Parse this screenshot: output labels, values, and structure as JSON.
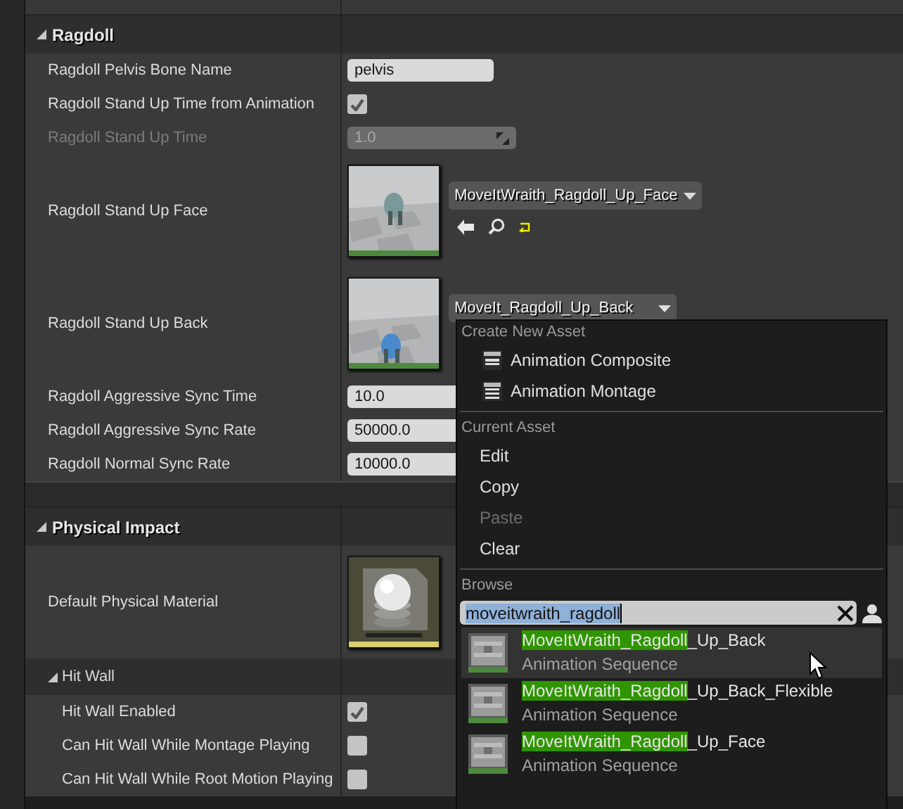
{
  "sections": [
    {
      "title": "Ragdoll",
      "expanded": true,
      "items": [
        {
          "kind": "text",
          "label": "Ragdoll Pelvis Bone Name",
          "value": "pelvis",
          "disabled": false
        },
        {
          "kind": "checkbox",
          "label": "Ragdoll Stand Up Time from Animation",
          "checked": true,
          "disabled": false
        },
        {
          "kind": "number",
          "label": "Ragdoll Stand Up Time",
          "value": "1.0",
          "disabled": true
        },
        {
          "kind": "asset",
          "label": "Ragdoll Stand Up Face",
          "value": "MoveItWraith_Ragdoll_Up_Face",
          "menu_open": false,
          "disabled": false
        },
        {
          "kind": "asset",
          "label": "Ragdoll Stand Up Back",
          "value": "MoveIt_Ragdoll_Up_Back",
          "menu_open": true,
          "disabled": false
        },
        {
          "kind": "number",
          "label": "Ragdoll Aggressive Sync Time",
          "value": "10.0",
          "disabled": false
        },
        {
          "kind": "number",
          "label": "Ragdoll Aggressive Sync Rate",
          "value": "50000.0",
          "disabled": false
        },
        {
          "kind": "number",
          "label": "Ragdoll Normal Sync Rate",
          "value": "10000.0",
          "disabled": false
        }
      ]
    },
    {
      "title": "Physical Impact",
      "expanded": true,
      "items": [
        {
          "kind": "material",
          "label": "Default Physical Material",
          "disabled": false
        },
        {
          "kind": "group",
          "title": "Hit Wall",
          "expanded": true,
          "items": [
            {
              "kind": "checkbox",
              "label": "Hit Wall Enabled",
              "checked": true,
              "disabled": false
            },
            {
              "kind": "checkbox",
              "label": "Can Hit Wall While Montage Playing",
              "checked": false,
              "disabled": false
            },
            {
              "kind": "checkbox",
              "label": "Can Hit Wall While Root Motion Playing",
              "checked": false,
              "disabled": false
            }
          ]
        }
      ]
    }
  ],
  "asset_menu": {
    "groups": [
      {
        "title": "Create New Asset",
        "items": [
          {
            "label": "Animation Composite",
            "disabled": false
          },
          {
            "label": "Animation Montage",
            "disabled": false
          }
        ]
      },
      {
        "title": "Current Asset",
        "items": [
          {
            "label": "Edit",
            "disabled": false
          },
          {
            "label": "Copy",
            "disabled": false
          },
          {
            "label": "Paste",
            "disabled": true
          },
          {
            "label": "Clear",
            "disabled": false
          }
        ]
      }
    ],
    "browse": {
      "title": "Browse",
      "search": "moveitwraith_ragdoll",
      "results": [
        {
          "match": "MoveItWraith_Ragdoll",
          "rest": "_Up_Back",
          "type": "Animation Sequence",
          "hovered": true
        },
        {
          "match": "MoveItWraith_Ragdoll",
          "rest": "_Up_Back_Flexible",
          "type": "Animation Sequence",
          "hovered": false
        },
        {
          "match": "MoveItWraith_Ragdoll",
          "rest": "_Up_Face",
          "type": "Animation Sequence",
          "hovered": false
        }
      ]
    }
  }
}
